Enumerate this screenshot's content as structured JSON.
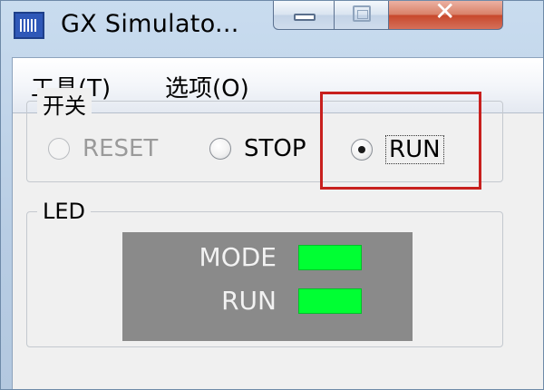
{
  "window": {
    "title": "GX Simulato..."
  },
  "menubar": {
    "items": [
      {
        "label": "工具(T)"
      },
      {
        "label": "选项(O)"
      }
    ]
  },
  "switch_group": {
    "legend": "开关",
    "options": [
      {
        "label": "RESET",
        "enabled": false,
        "selected": false
      },
      {
        "label": "STOP",
        "enabled": true,
        "selected": false
      },
      {
        "label": "RUN",
        "enabled": true,
        "selected": true
      }
    ]
  },
  "led_group": {
    "legend": "LED",
    "indicators": [
      {
        "label": "MODE",
        "color": "#00ff33"
      },
      {
        "label": "RUN",
        "color": "#00ff33"
      }
    ]
  },
  "highlight_color": "#c8201e"
}
